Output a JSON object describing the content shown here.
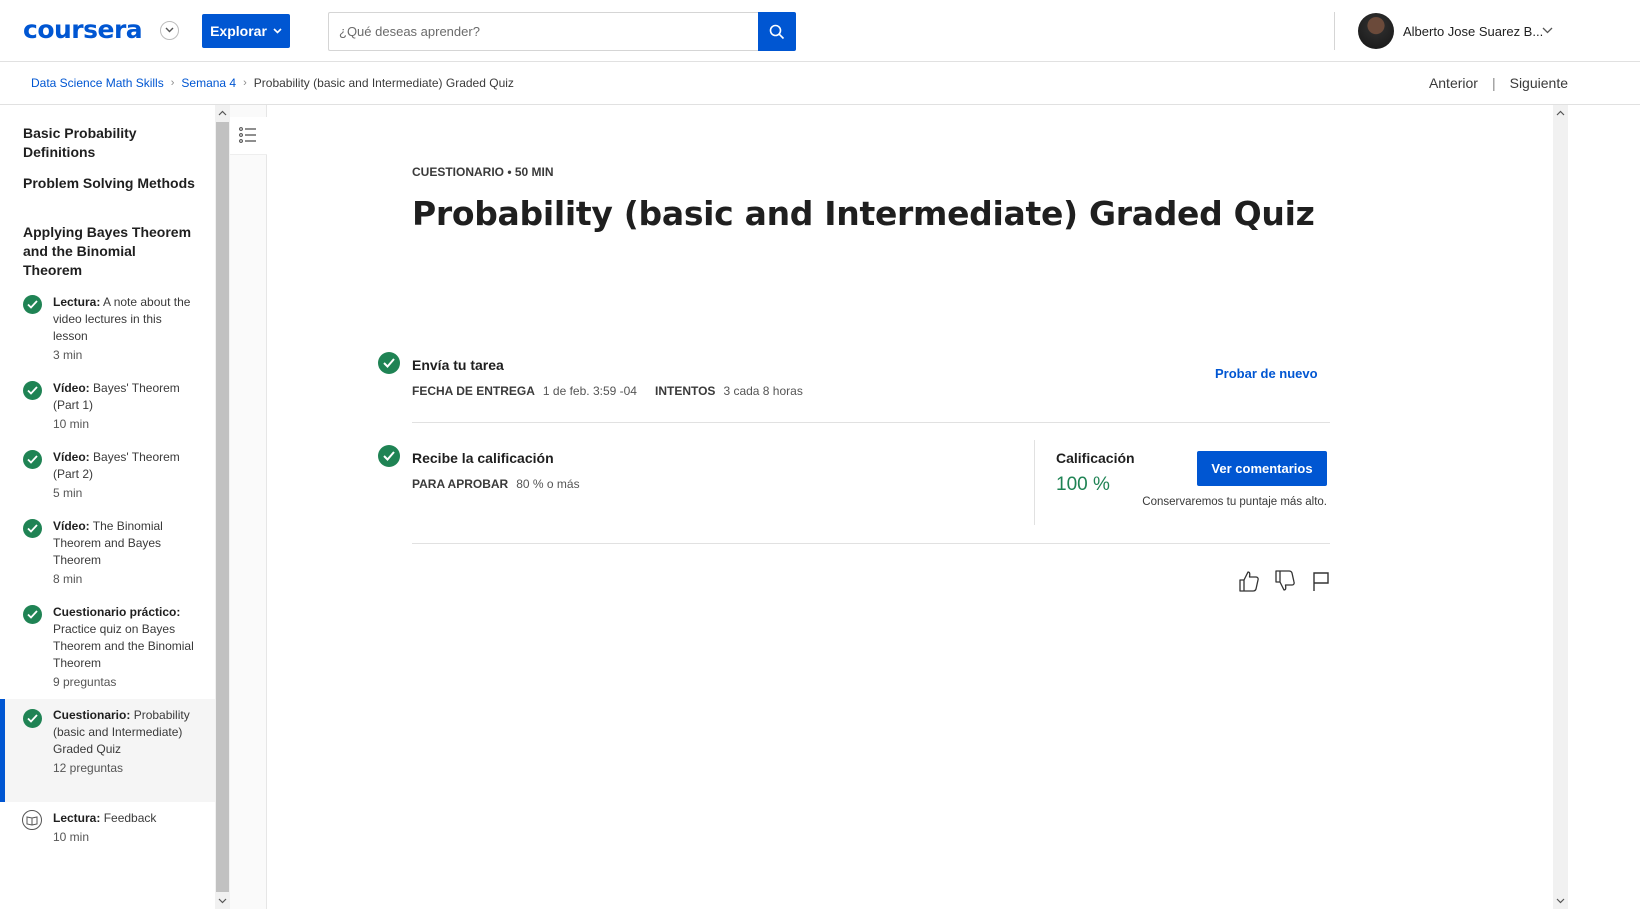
{
  "header": {
    "logo": "coursera",
    "explore_label": "Explorar",
    "search_placeholder": "¿Qué deseas aprender?",
    "user_name": "Alberto Jose Suarez B..."
  },
  "breadcrumb": {
    "items": [
      "Data Science Math Skills",
      "Semana 4",
      "Probability (basic and Intermediate) Graded Quiz"
    ],
    "prev_label": "Anterior",
    "next_label": "Siguiente"
  },
  "sidebar": {
    "sections": [
      "Basic Probability Definitions",
      "Problem Solving Methods",
      "Applying Bayes Theorem and the Binomial Theorem"
    ],
    "items": [
      {
        "type": "Lectura:",
        "title": "A note about the video lectures in this lesson",
        "duration": "3 min",
        "status": "completed"
      },
      {
        "type": "Vídeo:",
        "title": "Bayes' Theorem (Part 1)",
        "duration": "10 min",
        "status": "completed"
      },
      {
        "type": "Vídeo:",
        "title": "Bayes' Theorem (Part 2)",
        "duration": "5 min",
        "status": "completed"
      },
      {
        "type": "Vídeo:",
        "title": "The Binomial Theorem and Bayes Theorem",
        "duration": "8 min",
        "status": "completed"
      },
      {
        "type": "Cuestionario práctico:",
        "title": "Practice quiz on Bayes Theorem and the Binomial Theorem",
        "duration": "9 preguntas",
        "status": "completed"
      },
      {
        "type": "Cuestionario:",
        "title": "Probability (basic and Intermediate) Graded Quiz",
        "duration": "12 preguntas",
        "status": "completed",
        "active": true
      },
      {
        "type": "Lectura:",
        "title": "Feedback",
        "duration": "10 min",
        "status": "not-started"
      }
    ]
  },
  "main": {
    "meta": "CUESTIONARIO • 50 MIN",
    "title": "Probability (basic and Intermediate) Graded Quiz",
    "submit": {
      "title": "Envía tu tarea",
      "due_label": "FECHA DE ENTREGA",
      "due_value": "1 de feb. 3:59 -04",
      "attempts_label": "INTENTOS",
      "attempts_value": "3 cada 8 horas",
      "retry_label": "Probar de nuevo"
    },
    "grade": {
      "title": "Recibe la calificación",
      "pass_label": "PARA APROBAR",
      "pass_value": "80 % o más",
      "grade_label": "Calificación",
      "grade_value": "100 %",
      "feedback_button": "Ver comentarios",
      "keep_note": "Conservaremos tu puntaje más alto."
    },
    "reactions": [
      "thumbs-up-icon",
      "thumbs-down-icon",
      "flag-icon"
    ]
  },
  "colors": {
    "brand_blue": "#0056d2",
    "success_green": "#1f8354"
  }
}
